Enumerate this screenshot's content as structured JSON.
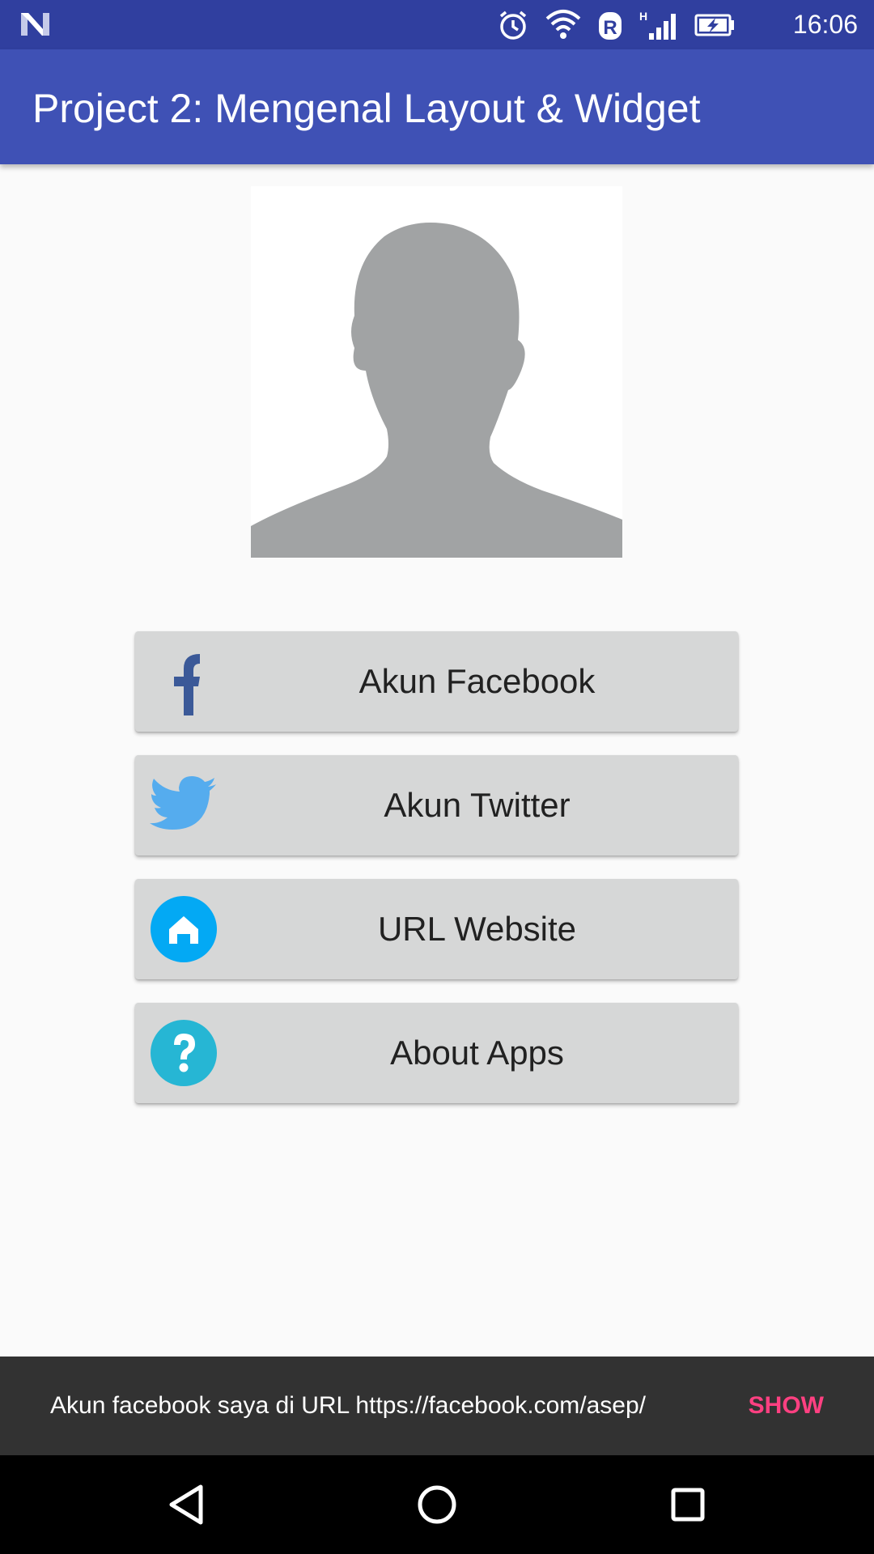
{
  "status_bar": {
    "time": "16:06",
    "icons": [
      "n-logo-icon",
      "alarm-icon",
      "wifi-icon",
      "roaming-r-icon",
      "signal-h-icon",
      "battery-charging-icon"
    ],
    "network_type": "H",
    "roaming_letter": "R"
  },
  "app_bar": {
    "title": "Project 2: Mengenal Layout & Widget",
    "color": "#3f51b5",
    "status_color": "#303f9f"
  },
  "profile": {
    "avatar_icon": "person-silhouette-icon"
  },
  "buttons": [
    {
      "label": "Akun Facebook",
      "icon": "facebook-icon",
      "icon_color": "#3b5998"
    },
    {
      "label": "Akun Twitter",
      "icon": "twitter-bird-icon",
      "icon_color": "#55acee"
    },
    {
      "label": "URL Website",
      "icon": "home-icon",
      "icon_color": "#03a9f4"
    },
    {
      "label": "About Apps",
      "icon": "help-icon",
      "icon_color": "#26b6d4"
    }
  ],
  "snackbar": {
    "message": "Akun facebook saya di URL https://facebook.com/asep/",
    "action": "SHOW",
    "action_color": "#ff4081"
  },
  "nav_bar": {
    "icons": [
      "back-icon",
      "home-circle-icon",
      "recents-icon"
    ]
  }
}
